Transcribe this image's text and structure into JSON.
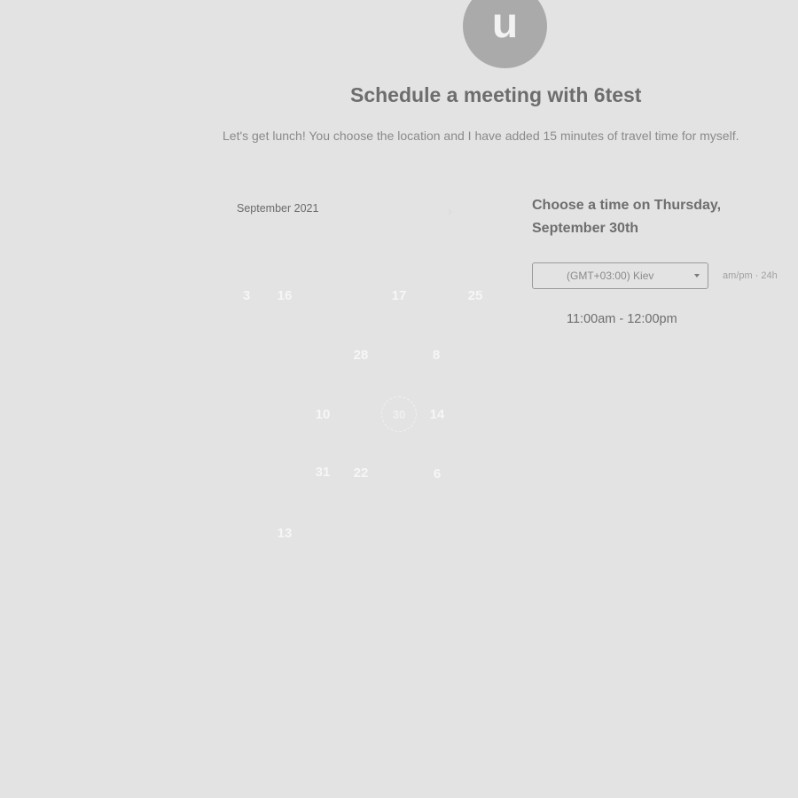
{
  "host": {
    "avatar_letter": "u",
    "title": "Schedule a meeting with 6test",
    "description": "Let's get lunch! You choose the location and I have added 15 minutes of travel time for myself."
  },
  "calendar": {
    "month_label": "September 2021",
    "next_icon": "chevron-right-icon",
    "next_glyph": "›",
    "days": [
      "3",
      "16",
      "17",
      "25",
      "28",
      "8",
      "10",
      "30",
      "14",
      "31",
      "22",
      "6",
      "13"
    ],
    "selected_day": "30"
  },
  "times": {
    "heading": "Choose a time on Thursday, September 30th",
    "timezone": "(GMT+03:00) Kiev",
    "format_ampm": "am/pm",
    "format_separator": "·",
    "format_24h": "24h",
    "slots": [
      "11:00am - 12:00pm"
    ]
  }
}
